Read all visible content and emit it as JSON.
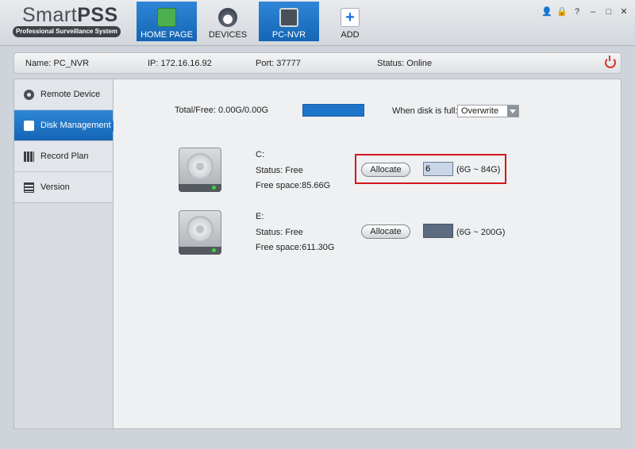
{
  "app": {
    "logo_main": "Smart",
    "logo_bold": "PSS",
    "logo_sub": "Professional Surveillance System"
  },
  "tabs": [
    {
      "label": "HOME PAGE",
      "icon": "home-icon",
      "active": true
    },
    {
      "label": "DEVICES",
      "icon": "camera-icon",
      "active": false
    },
    {
      "label": "PC-NVR",
      "icon": "nvr-icon",
      "active": true
    },
    {
      "label": "ADD",
      "icon": "add-icon",
      "active": false
    }
  ],
  "window_controls": {
    "user": "👤",
    "lock": "🔒",
    "help": "?",
    "minimize": "–",
    "maximize": "□",
    "close": "✕"
  },
  "info": {
    "name": "Name:  PC_NVR",
    "ip": "IP:  172.16.16.92",
    "port": "Port:    37777",
    "status": "Status: Online"
  },
  "sidebar": {
    "items": [
      {
        "label": "Remote Device",
        "icon": "gear-icon"
      },
      {
        "label": "Disk Management",
        "icon": "disk-icon"
      },
      {
        "label": "Record Plan",
        "icon": "record-icon"
      },
      {
        "label": "Version",
        "icon": "version-icon"
      }
    ]
  },
  "disk": {
    "total_free": "Total/Free: 0.00G/0.00G",
    "when_full_label": "When disk is full:",
    "when_full_value": "Overwrite",
    "drives": [
      {
        "name": "C:",
        "status": "Status: Free",
        "free": "Free space:85.66G",
        "button": "Allocate",
        "value": "6",
        "range": "(6G ~ 84G)"
      },
      {
        "name": "E:",
        "status": "Status: Free",
        "free": "Free space:611.30G",
        "button": "Allocate",
        "value": "",
        "range": "(6G ~ 200G)"
      }
    ]
  },
  "colors": {
    "accent": "#1b6fc0",
    "highlight": "#d4161b",
    "online_power": "#d9342b"
  }
}
